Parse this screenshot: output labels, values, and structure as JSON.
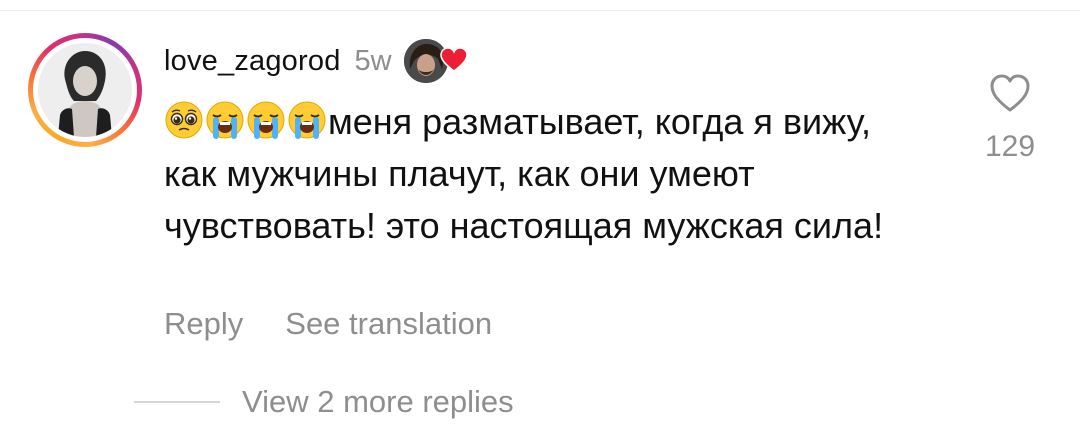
{
  "comment": {
    "username": "love_zagorod",
    "time": "5w",
    "text": "меня разматывает, когда я вижу, как мужчины плачут, как они умеют чувствовать! это настоящая мужская сила!",
    "emojis": [
      "pleading-face",
      "loudly-crying-face",
      "loudly-crying-face",
      "loudly-crying-face"
    ],
    "liked_by_creator": true
  },
  "actions": {
    "reply_label": "Reply",
    "translate_label": "See translation"
  },
  "like": {
    "count": "129",
    "icon": "heart-outline-icon"
  },
  "replies": {
    "view_more_label": "View 2 more replies"
  },
  "colors": {
    "secondary_text": "#8e8e8e",
    "heart_red": "#ed1d35",
    "story_ring": [
      "#fcaf45",
      "#f77737",
      "#e1306c",
      "#c13584",
      "#833ab4"
    ]
  }
}
